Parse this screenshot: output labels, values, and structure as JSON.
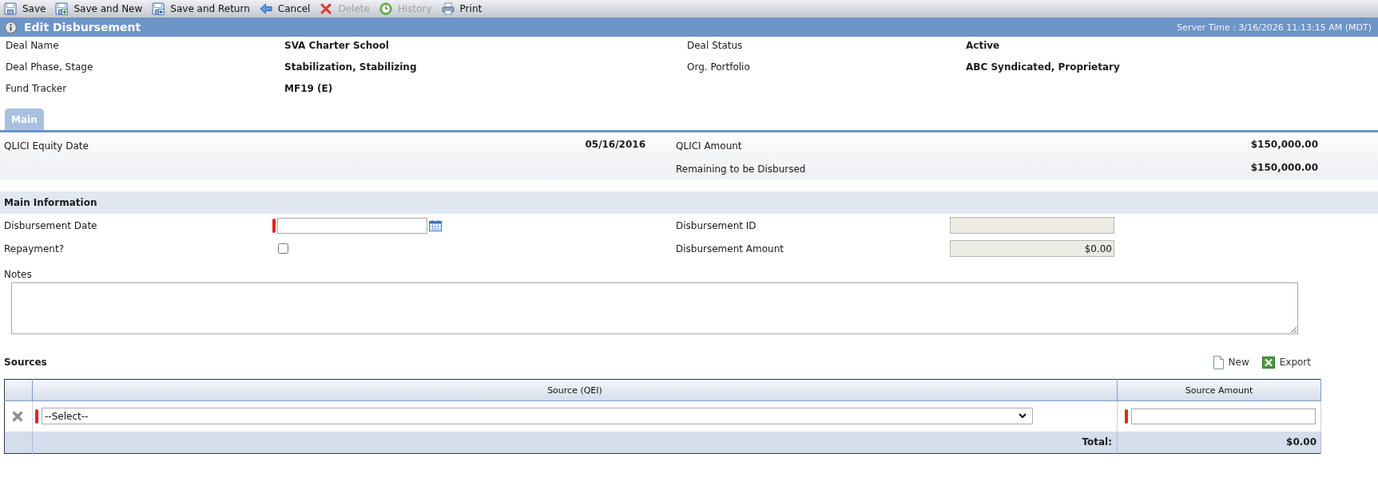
{
  "toolbar": [
    {
      "label": "Save",
      "disabled": false
    },
    {
      "label": "Save and New",
      "disabled": false
    },
    {
      "label": "Save and Return",
      "disabled": false
    },
    {
      "label": "Cancel",
      "disabled": false
    },
    {
      "label": "Delete",
      "disabled": true
    },
    {
      "label": "History",
      "disabled": true
    },
    {
      "label": "Print",
      "disabled": false
    }
  ],
  "header": {
    "title": "Edit Disbursement",
    "server_time": "Server Time : 3/16/2026 11:13:15 AM (MDT)"
  },
  "deal_info": [
    {
      "label": "Deal Name",
      "value": "SVA Charter School"
    },
    {
      "label": "Deal Status",
      "value": "Active"
    },
    {
      "label": "Deal Phase, Stage",
      "value": "Stabilization, Stabilizing"
    },
    {
      "label": "Org. Portfolio",
      "value": "ABC Syndicated, Proprietary"
    },
    {
      "label": "Fund Tracker",
      "value": "MF19 (E)"
    }
  ],
  "tabs": [
    {
      "label": "Main",
      "selected": true
    }
  ],
  "qlici": {
    "left": [
      {
        "label": "QLICI Equity Date",
        "value": "05/16/2016"
      }
    ],
    "right": [
      {
        "label": "QLICI Amount",
        "value": "$150,000.00"
      },
      {
        "label": "Remaining to be Disbursed",
        "value": "$150,000.00"
      }
    ]
  },
  "main_information": {
    "title": "Main Information",
    "fields": [
      {
        "label": "Disbursement Date",
        "kind": "date",
        "required": true,
        "disabled": false
      },
      {
        "label": "Disbursement ID",
        "kind": "text",
        "required": false,
        "disabled": true
      },
      {
        "label": "Repayment?",
        "kind": "checkbox",
        "required": false,
        "disabled": false,
        "checked": false
      },
      {
        "label": "Disbursement Amount",
        "kind": "text",
        "required": false,
        "disabled": true,
        "value": "$0.00"
      }
    ]
  },
  "notes": {
    "label": "Notes"
  },
  "sources": {
    "title": "Sources",
    "actions": [
      "New",
      "Export"
    ],
    "columns": [
      "Source (QEI)",
      "Source Amount"
    ],
    "rows": [
      {
        "source": {
          "value": "--Select--",
          "required": true
        },
        "amount": {
          "required": true
        }
      }
    ],
    "total": {
      "label": "Total:",
      "value": "$0.00"
    }
  }
}
